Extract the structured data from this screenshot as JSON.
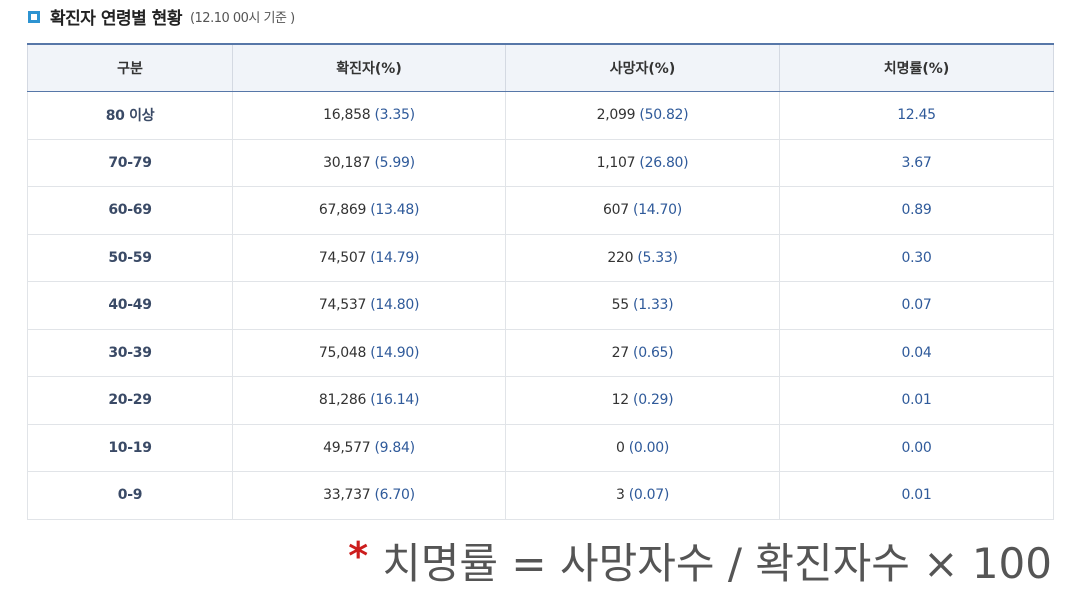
{
  "header": {
    "title": "확진자 연령별 현황",
    "note": "(12.10 00시 기준 )"
  },
  "table": {
    "columns": [
      "구분",
      "확진자(%)",
      "사망자(%)",
      "치명률(%)"
    ],
    "rows": [
      {
        "age": "80 이상",
        "cases": "16,858",
        "cases_pct": "(3.35)",
        "deaths": "2,099",
        "deaths_pct": "(50.82)",
        "cfr": "12.45"
      },
      {
        "age": "70-79",
        "cases": "30,187",
        "cases_pct": "(5.99)",
        "deaths": "1,107",
        "deaths_pct": "(26.80)",
        "cfr": "3.67"
      },
      {
        "age": "60-69",
        "cases": "67,869",
        "cases_pct": "(13.48)",
        "deaths": "607",
        "deaths_pct": "(14.70)",
        "cfr": "0.89"
      },
      {
        "age": "50-59",
        "cases": "74,507",
        "cases_pct": "(14.79)",
        "deaths": "220",
        "deaths_pct": "(5.33)",
        "cfr": "0.30"
      },
      {
        "age": "40-49",
        "cases": "74,537",
        "cases_pct": "(14.80)",
        "deaths": "55",
        "deaths_pct": "(1.33)",
        "cfr": "0.07"
      },
      {
        "age": "30-39",
        "cases": "75,048",
        "cases_pct": "(14.90)",
        "deaths": "27",
        "deaths_pct": "(0.65)",
        "cfr": "0.04"
      },
      {
        "age": "20-29",
        "cases": "81,286",
        "cases_pct": "(16.14)",
        "deaths": "12",
        "deaths_pct": "(0.29)",
        "cfr": "0.01"
      },
      {
        "age": "10-19",
        "cases": "49,577",
        "cases_pct": "(9.84)",
        "deaths": "0",
        "deaths_pct": "(0.00)",
        "cfr": "0.00"
      },
      {
        "age": "0-9",
        "cases": "33,737",
        "cases_pct": "(6.70)",
        "deaths": "3",
        "deaths_pct": "(0.07)",
        "cfr": "0.01"
      }
    ]
  },
  "footnote": {
    "marker": "*",
    "formula": "치명률 = 사망자수 / 확진자수 × 100"
  },
  "colors": {
    "accent": "#2d93d1",
    "header_border": "#5777a8",
    "header_bg": "#f1f4f9",
    "value_blue": "#2f5a9a",
    "asterisk_red": "#cc1d1d"
  },
  "icons": {
    "title_marker": "square-bullet-icon"
  }
}
